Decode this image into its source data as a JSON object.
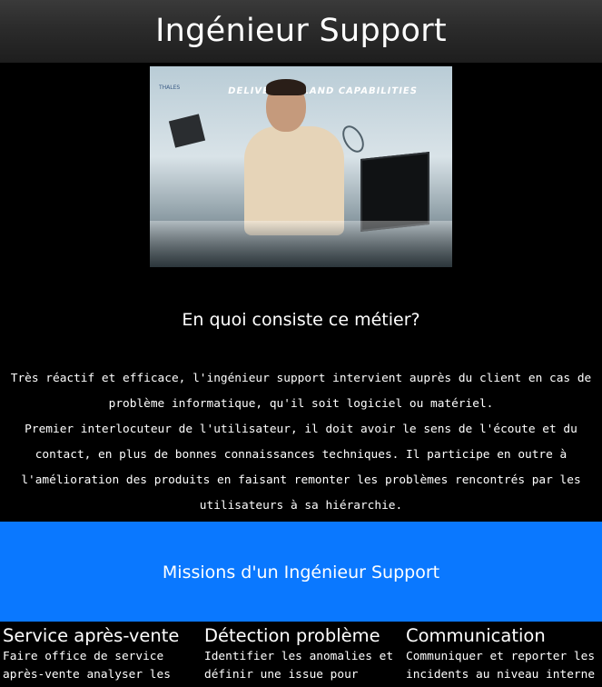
{
  "header": {
    "title": "Ingénieur Support"
  },
  "hero_image": {
    "banner_text": "DELIVERING LAND CAPABILITIES",
    "logo_text": "THALES"
  },
  "section_intro": {
    "title": "En quoi consiste ce métier?",
    "paragraph_1": "Très réactif et efficace, l'ingénieur support intervient auprès du client en cas de problème informatique, qu'il soit logiciel ou matériel.",
    "paragraph_2": "Premier interlocuteur de l'utilisateur, il doit avoir le sens de l'écoute et du contact, en plus de bonnes connaissances techniques. Il participe en outre à l'amélioration des produits en faisant remonter les problèmes rencontrés par les utilisateurs à sa hiérarchie."
  },
  "missions": {
    "title": "Missions d'un Ingénieur Support",
    "band_color": "#0a78ff",
    "columns": [
      {
        "heading": "Service après-vente",
        "text": "Faire office de service après-vente analyser les"
      },
      {
        "heading": "Détection problème",
        "text": "Identifier les anomalies et définir une issue pour"
      },
      {
        "heading": "Communication",
        "text": "Communiquer et reporter les incidents au niveau interne"
      }
    ]
  }
}
